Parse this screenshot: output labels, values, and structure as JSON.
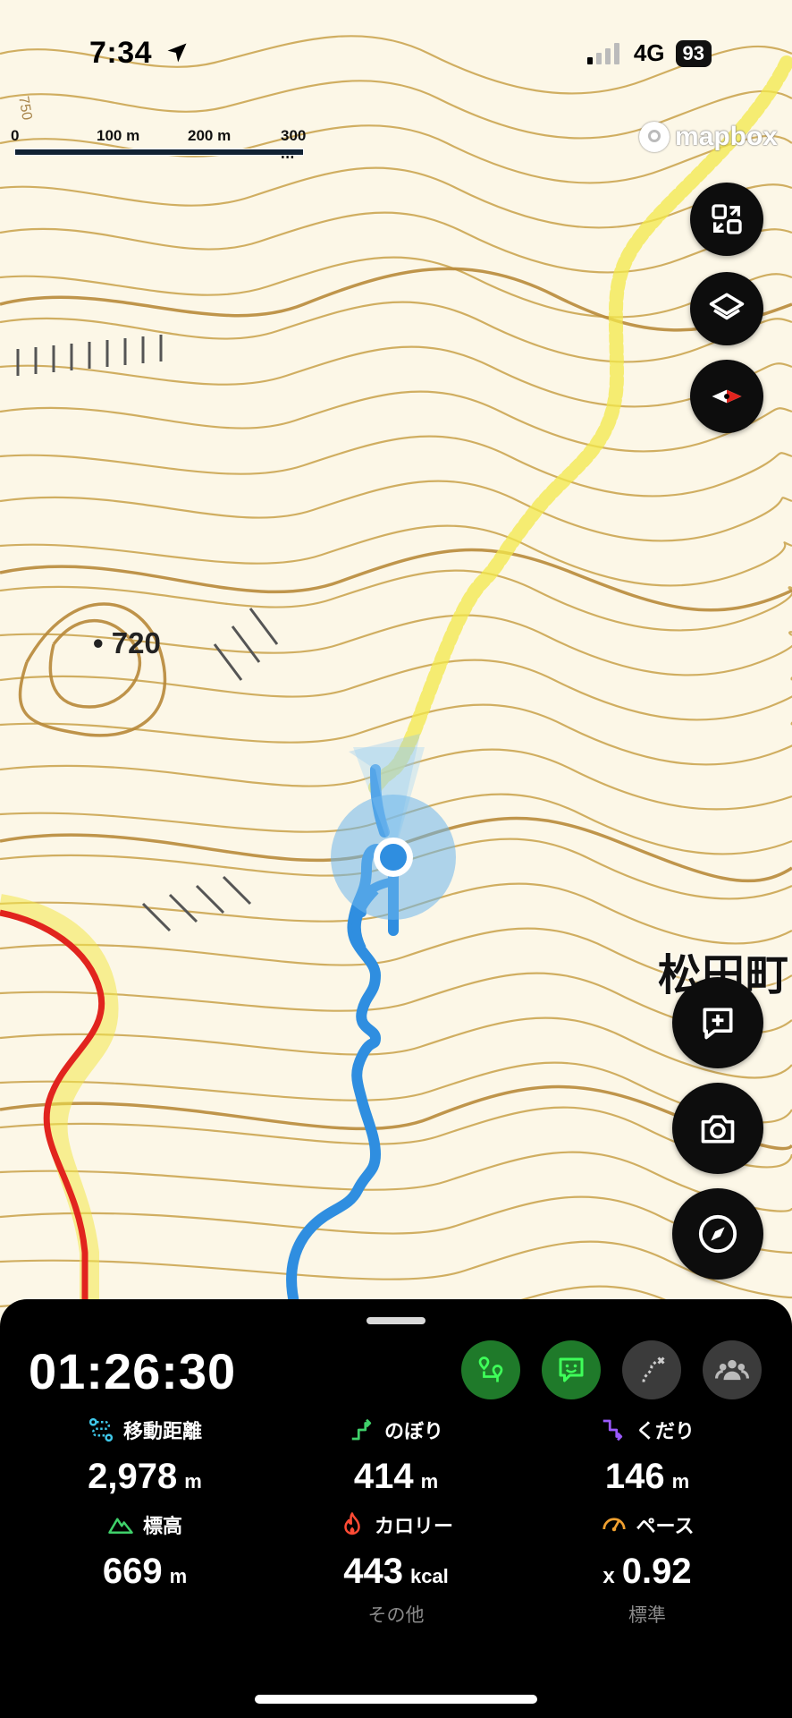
{
  "status_bar": {
    "time": "7:34",
    "network": "4G",
    "battery": "93"
  },
  "map": {
    "scale_labels": [
      "0",
      "100 m",
      "200 m",
      "300 m"
    ],
    "attribution": "mapbox",
    "elevation_point": "720",
    "contour_label": "750",
    "place_name": "松田町"
  },
  "map_controls": {
    "fit_icon": "fit-bounds-icon",
    "layers_icon": "layers-icon",
    "compass_icon": "compass-needle-icon",
    "memo_icon": "add-memo-icon",
    "camera_icon": "camera-icon",
    "navigate_icon": "navigation-compass-icon"
  },
  "activity": {
    "elapsed": "01:26:30",
    "modes": [
      {
        "name": "route-guide",
        "icon": "route-pin-icon",
        "active": true
      },
      {
        "name": "mood",
        "icon": "chat-smile-icon",
        "active": true
      },
      {
        "name": "off-route",
        "icon": "off-route-icon",
        "active": false
      },
      {
        "name": "group",
        "icon": "group-icon",
        "active": false
      }
    ],
    "stats": {
      "distance": {
        "label": "移動距離",
        "value": "2,978",
        "unit": "m",
        "icon": "distance-icon"
      },
      "ascent": {
        "label": "のぼり",
        "value": "414",
        "unit": "m",
        "icon": "ascent-icon"
      },
      "descent": {
        "label": "くだり",
        "value": "146",
        "unit": "m",
        "icon": "descent-icon"
      },
      "elevation": {
        "label": "標高",
        "value": "669",
        "unit": "m",
        "icon": "mountain-icon"
      },
      "calories": {
        "label": "カロリー",
        "value": "443",
        "unit": "kcal",
        "sub": "その他",
        "icon": "flame-icon"
      },
      "pace": {
        "label": "ペース",
        "prefix": "x",
        "value": "0.92",
        "sub": "標準",
        "icon": "speedometer-icon"
      }
    }
  },
  "colors": {
    "contour": "#c9a24a",
    "trail_yellow": "#f3e84a",
    "road_red": "#e1241e",
    "track_blue": "#2f8ee0",
    "active_mode": "#1f7a2a",
    "stat_ascent": "#3fd06a",
    "stat_descent": "#9b59ff",
    "stat_calories": "#ff4b35",
    "stat_pace": "#f0a030"
  }
}
